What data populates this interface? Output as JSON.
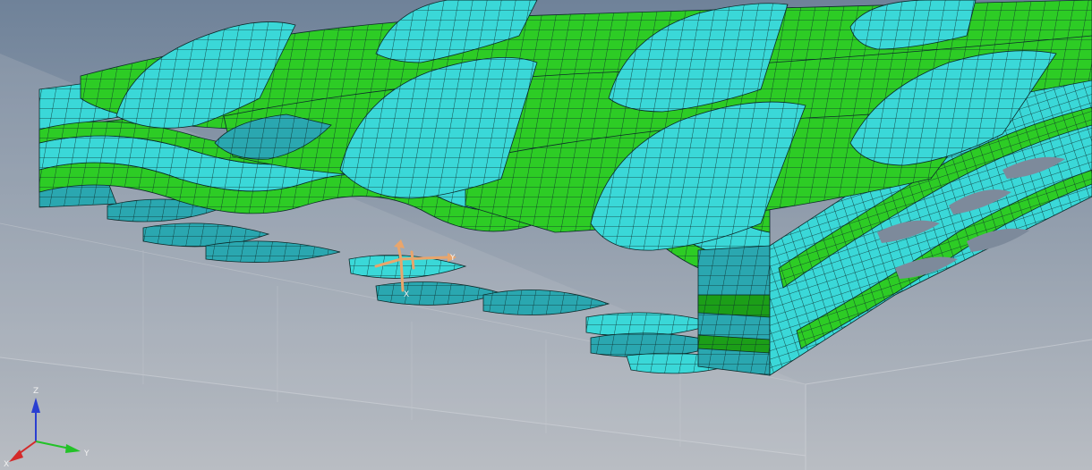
{
  "viewport": {
    "background_top": "#6f8299",
    "background_bottom": "#b9bdc3"
  },
  "materials": {
    "cyan": "#3ad8d8",
    "cyan_dark": "#2aa7b0",
    "green": "#2dcc25",
    "green_dark": "#1c9e18",
    "mesh": "#0c2a2a"
  },
  "local_csys": {
    "color": "#e9a56b",
    "y_label": "Y",
    "x_label": "X"
  },
  "triad": {
    "z_label": "Z",
    "y_label": "Y",
    "x_label": "X",
    "z_color": "#2a3fd1",
    "y_color": "#22c227",
    "x_color": "#d42a2a"
  }
}
